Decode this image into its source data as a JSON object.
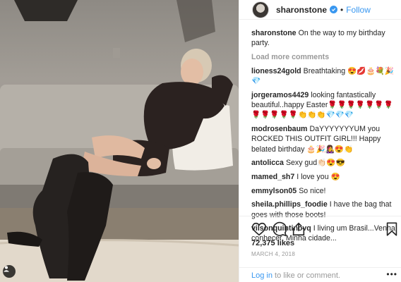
{
  "header": {
    "username": "sharonstone",
    "separator": "•",
    "follow_label": "Follow"
  },
  "caption": {
    "user": "sharonstone",
    "text": "On the way to my birthday party."
  },
  "load_more_label": "Load more comments",
  "comments": [
    {
      "user": "lioness24gold",
      "text": "Breathtaking 😍💋🎂💐🎉💎"
    },
    {
      "user": "jorgeramos4429",
      "text": "looking fantastically beautiful..happy Easter🌹🌹🌹🌹🌹🌹🌹🌹🌹🌹🌹🌹👏👏👏💎💎💎"
    },
    {
      "user": "modrosenbaum",
      "text": "DaYYYYYYYUM you ROCKED THIS OUTFIT GIRL!!! Happy belated birthday 🎂🎉👩‍🎤😍👏"
    },
    {
      "user": "antolicca",
      "text": "Sexy gud👏🏻😍😎"
    },
    {
      "user": "mamed_sh7",
      "text": "I love you 😍"
    },
    {
      "user": "emmylson05",
      "text": "So nice!"
    },
    {
      "user": "sheila.phillips_foodie",
      "text": "I have the bag that goes with those boots!"
    },
    {
      "user": "vilsonquintinovq",
      "text": "I living um Brasil...Venha conhecer. Minha cidade..."
    }
  ],
  "actions": {
    "icons": [
      "heart-icon",
      "comment-icon",
      "share-icon",
      "bookmark-icon"
    ]
  },
  "likes": "72,375 likes",
  "date": "MARCH 4, 2018",
  "login": {
    "link": "Log in",
    "rest": " to like or comment.",
    "more": "•••"
  },
  "colors": {
    "link_blue": "#3897f0",
    "text": "#262626",
    "muted": "#999999",
    "divider": "#efefef"
  }
}
